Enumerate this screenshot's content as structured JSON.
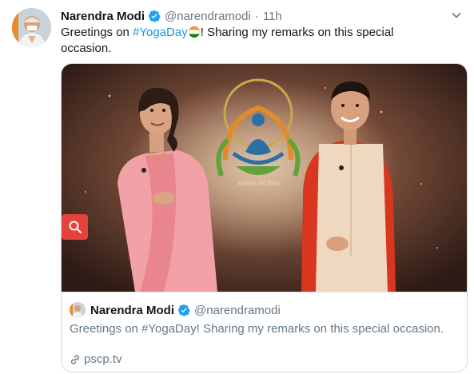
{
  "tweet": {
    "author_name": "Narendra Modi",
    "handle": "@narendramodi",
    "separator": "·",
    "time": "11h",
    "text_before": "Greetings on ",
    "hashtag": "#YogaDay",
    "text_after": "! Sharing my remarks on this special occasion."
  },
  "quoted": {
    "author_name": "Narendra Modi",
    "handle": "@narendramodi",
    "text": "Greetings on #YogaDay! Sharing my remarks on this special occasion.",
    "link": "pscp.tv"
  },
  "icons": {
    "verified": "verified-badge-icon",
    "caret": "chevron-down-icon",
    "search": "search-icon",
    "link": "link-icon",
    "flag": "india-flag-emoji"
  },
  "colors": {
    "accent": "#1b95e0",
    "verified": "#1da1f2",
    "zoom_button": "#e6413b",
    "muted": "#657786"
  }
}
